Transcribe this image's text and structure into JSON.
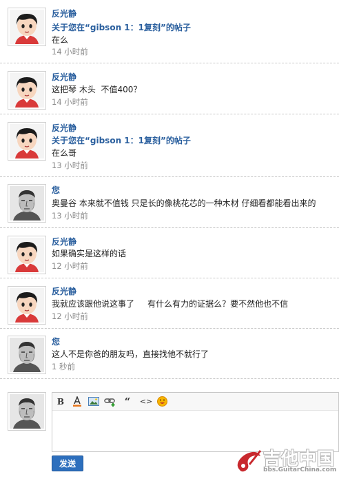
{
  "messages": [
    {
      "avatar": "cartoon-girl-avatar",
      "name": "反光静",
      "subject": "关于您在“gibson 1：1复刻”的帖子",
      "body": "在么",
      "time": "14 小时前"
    },
    {
      "avatar": "cartoon-girl-avatar",
      "name": "反光静",
      "subject": "",
      "body": "这把琴 木头  不值400？",
      "time": "14 小时前"
    },
    {
      "avatar": "cartoon-girl-avatar",
      "name": "反光静",
      "subject": "关于您在“gibson 1：1复刻”的帖子",
      "body": "在么哥",
      "time": "13 小时前"
    },
    {
      "avatar": "sketch-man-avatar",
      "name": "您",
      "subject": "",
      "body": "奥曼谷 本来就不值钱 只是长的像桃花芯的一种木材 仔细看都能看出来的",
      "time": "13 小时前"
    },
    {
      "avatar": "cartoon-girl-avatar",
      "name": "反光静",
      "subject": "",
      "body": "如果确实是这样的话",
      "time": "12 小时前"
    },
    {
      "avatar": "cartoon-girl-avatar",
      "name": "反光静",
      "subject": "",
      "body": "我就应该跟他说这事了     有什么有力的证据么？要不然他也不信",
      "time": "12 小时前"
    },
    {
      "avatar": "sketch-man-avatar",
      "name": "您",
      "subject": "",
      "body": "这人不是你爸的朋友吗，直接找他不就行了",
      "time": "1 秒前"
    }
  ],
  "reply": {
    "avatar": "sketch-man-avatar",
    "toolbar": {
      "bold": "B",
      "quote": "“",
      "code": "<>"
    },
    "text": "",
    "send_label": "发送"
  },
  "watermark": {
    "text": "吉他中国",
    "url": "bbs.GuitarChina.com"
  },
  "colors": {
    "name": "#2a5f9e",
    "time": "#8a8a8a",
    "send_button": "#2d6fbd"
  }
}
